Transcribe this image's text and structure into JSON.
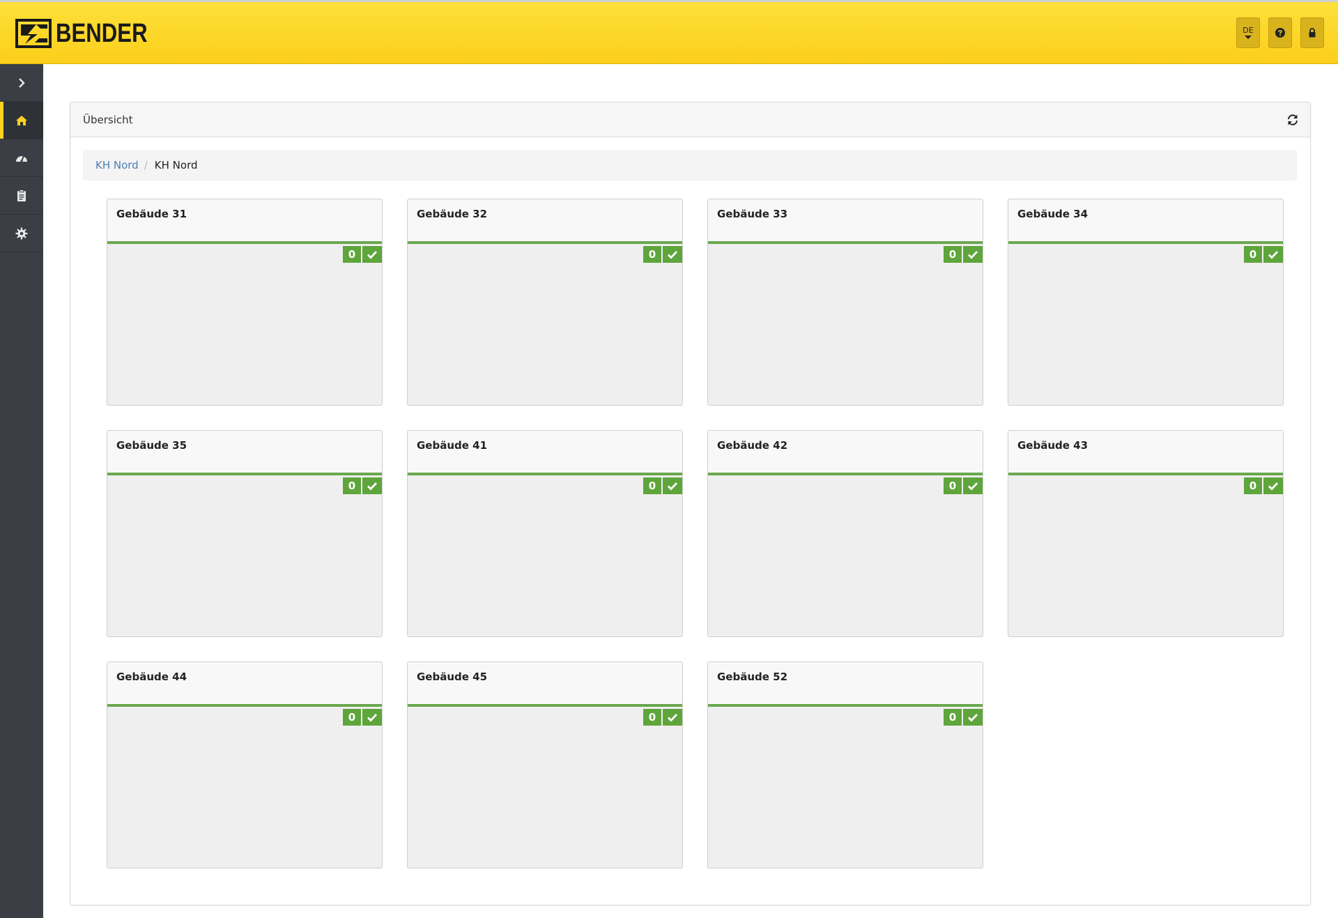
{
  "header": {
    "brand": "BENDER",
    "language": "DE",
    "accent_color": "#fcd21e"
  },
  "sidebar": {
    "items": [
      {
        "name": "expand",
        "icon": "chevron-right-icon"
      },
      {
        "name": "home",
        "icon": "home-icon",
        "active": true
      },
      {
        "name": "dashboard",
        "icon": "dashboard-icon"
      },
      {
        "name": "report",
        "icon": "clipboard-icon"
      },
      {
        "name": "settings",
        "icon": "gear-icon"
      }
    ]
  },
  "panel": {
    "title": "Übersicht",
    "breadcrumb": {
      "link": "KH Nord",
      "separator": "/",
      "current": "KH Nord"
    }
  },
  "cards": [
    {
      "title": "Gebäude 31",
      "count": "0"
    },
    {
      "title": "Gebäude 32",
      "count": "0"
    },
    {
      "title": "Gebäude 33",
      "count": "0"
    },
    {
      "title": "Gebäude 34",
      "count": "0"
    },
    {
      "title": "Gebäude 35",
      "count": "0"
    },
    {
      "title": "Gebäude 41",
      "count": "0"
    },
    {
      "title": "Gebäude 42",
      "count": "0"
    },
    {
      "title": "Gebäude 43",
      "count": "0"
    },
    {
      "title": "Gebäude 44",
      "count": "0"
    },
    {
      "title": "Gebäude 45",
      "count": "0"
    },
    {
      "title": "Gebäude 52",
      "count": "0"
    }
  ],
  "status_color": "#5ea53b"
}
